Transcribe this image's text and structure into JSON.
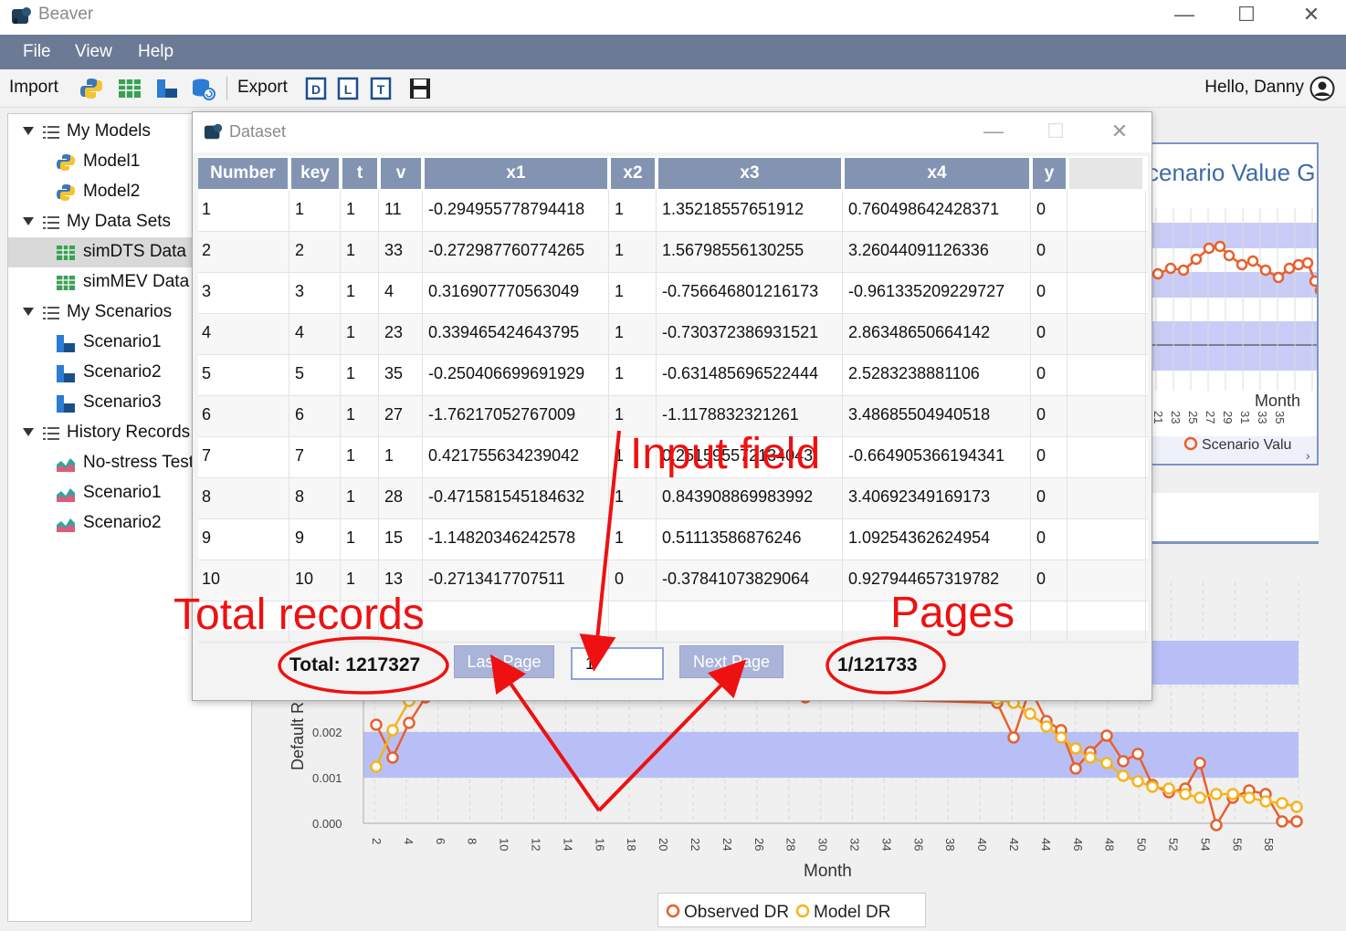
{
  "window": {
    "title": "Beaver"
  },
  "menu": {
    "items": [
      "File",
      "View",
      "Help"
    ]
  },
  "toolbar": {
    "import_label": "Import",
    "export_label": "Export",
    "greeting": "Hello, Danny"
  },
  "tree": {
    "items": [
      {
        "label": "My Models",
        "level": 0,
        "icon": "list-icon"
      },
      {
        "label": "Model1",
        "level": 1,
        "icon": "python-icon"
      },
      {
        "label": "Model2",
        "level": 1,
        "icon": "python-icon"
      },
      {
        "label": "My Data Sets",
        "level": 0,
        "icon": "list-icon"
      },
      {
        "label": "simDTS Data",
        "level": 1,
        "icon": "table-icon",
        "selected": true
      },
      {
        "label": "simMEV Data",
        "level": 1,
        "icon": "table-icon"
      },
      {
        "label": "My Scenarios",
        "level": 0,
        "icon": "list-icon"
      },
      {
        "label": "Scenario1",
        "level": 1,
        "icon": "scenario-icon"
      },
      {
        "label": "Scenario2",
        "level": 1,
        "icon": "scenario-icon"
      },
      {
        "label": "Scenario3",
        "level": 1,
        "icon": "scenario-icon"
      },
      {
        "label": "History Records",
        "level": 0,
        "icon": "list-icon"
      },
      {
        "label": "No-stress Test",
        "level": 1,
        "icon": "area-chart-icon"
      },
      {
        "label": "Scenario1",
        "level": 1,
        "icon": "area-chart-icon"
      },
      {
        "label": "Scenario2",
        "level": 1,
        "icon": "area-chart-icon"
      }
    ]
  },
  "dialog": {
    "title": "Dataset",
    "columns": [
      "Number",
      "key",
      "t",
      "v",
      "x1",
      "x2",
      "x3",
      "x4",
      "y"
    ],
    "rows": [
      [
        "1",
        "1",
        "1",
        "11",
        "-0.294955778794418",
        "1",
        "1.35218557651912",
        "0.760498642428371",
        "0"
      ],
      [
        "2",
        "2",
        "1",
        "33",
        "-0.272987760774265",
        "1",
        "1.56798556130255",
        "3.26044091126336",
        "0"
      ],
      [
        "3",
        "3",
        "1",
        "4",
        "0.316907770563049",
        "1",
        "-0.756646801216173",
        "-0.961335209229727",
        "0"
      ],
      [
        "4",
        "4",
        "1",
        "23",
        "0.339465424643795",
        "1",
        "-0.730372386931521",
        "2.86348650664142",
        "0"
      ],
      [
        "5",
        "5",
        "1",
        "35",
        "-0.250406699691929",
        "1",
        "-0.631485696522444",
        "2.5283238881106",
        "0"
      ],
      [
        "6",
        "6",
        "1",
        "27",
        "-1.76217052767009",
        "1",
        "-1.1178832321261",
        "3.48685504940518",
        "0"
      ],
      [
        "7",
        "7",
        "1",
        "1",
        "0.421755634239042",
        "1",
        "0.251595572134043",
        "-0.664905366194341",
        "0"
      ],
      [
        "8",
        "8",
        "1",
        "28",
        "-0.471581545184632",
        "1",
        "0.843908869983992",
        "3.40692349169173",
        "0"
      ],
      [
        "9",
        "9",
        "1",
        "15",
        "-1.14820346242578",
        "1",
        "0.51113586876246",
        "1.09254362624954",
        "0"
      ],
      [
        "10",
        "10",
        "1",
        "13",
        "-0.2713417707511",
        "0",
        "-0.37841073829064",
        "0.927944657319782",
        "0"
      ]
    ],
    "total_text": "Total: 1217327",
    "last_page_label": "Last Page",
    "page_input_value": "1",
    "next_page_label": "Next Page",
    "pages_text": "1/121733"
  },
  "annotations": {
    "input_field": "Input field",
    "total_records": "Total records",
    "pages": "Pages",
    "color": "#ee1111"
  },
  "background_chart": {
    "top_title_fragment": "cenario Value G",
    "top_xlabel": "Month",
    "top_ticks": [
      "21",
      "23",
      "25",
      "27",
      "29",
      "31",
      "33",
      "35"
    ],
    "top_legend_fragment": "Scenario Valu",
    "y_label": "Default R",
    "x_label": "Month",
    "y_ticks": [
      "0.000",
      "0.001",
      "0.002"
    ],
    "x_ticks": [
      "2",
      "4",
      "6",
      "8",
      "10",
      "12",
      "14",
      "16",
      "18",
      "20",
      "22",
      "24",
      "26",
      "28",
      "30",
      "32",
      "34",
      "36",
      "38",
      "40",
      "42",
      "44",
      "46",
      "48",
      "50",
      "52",
      "54",
      "56",
      "58"
    ],
    "legend": [
      "Observed DR",
      "Model DR"
    ],
    "observed_color": "#e8602c",
    "model_color": "#f5b41e",
    "band_color": "#b8bff7"
  }
}
